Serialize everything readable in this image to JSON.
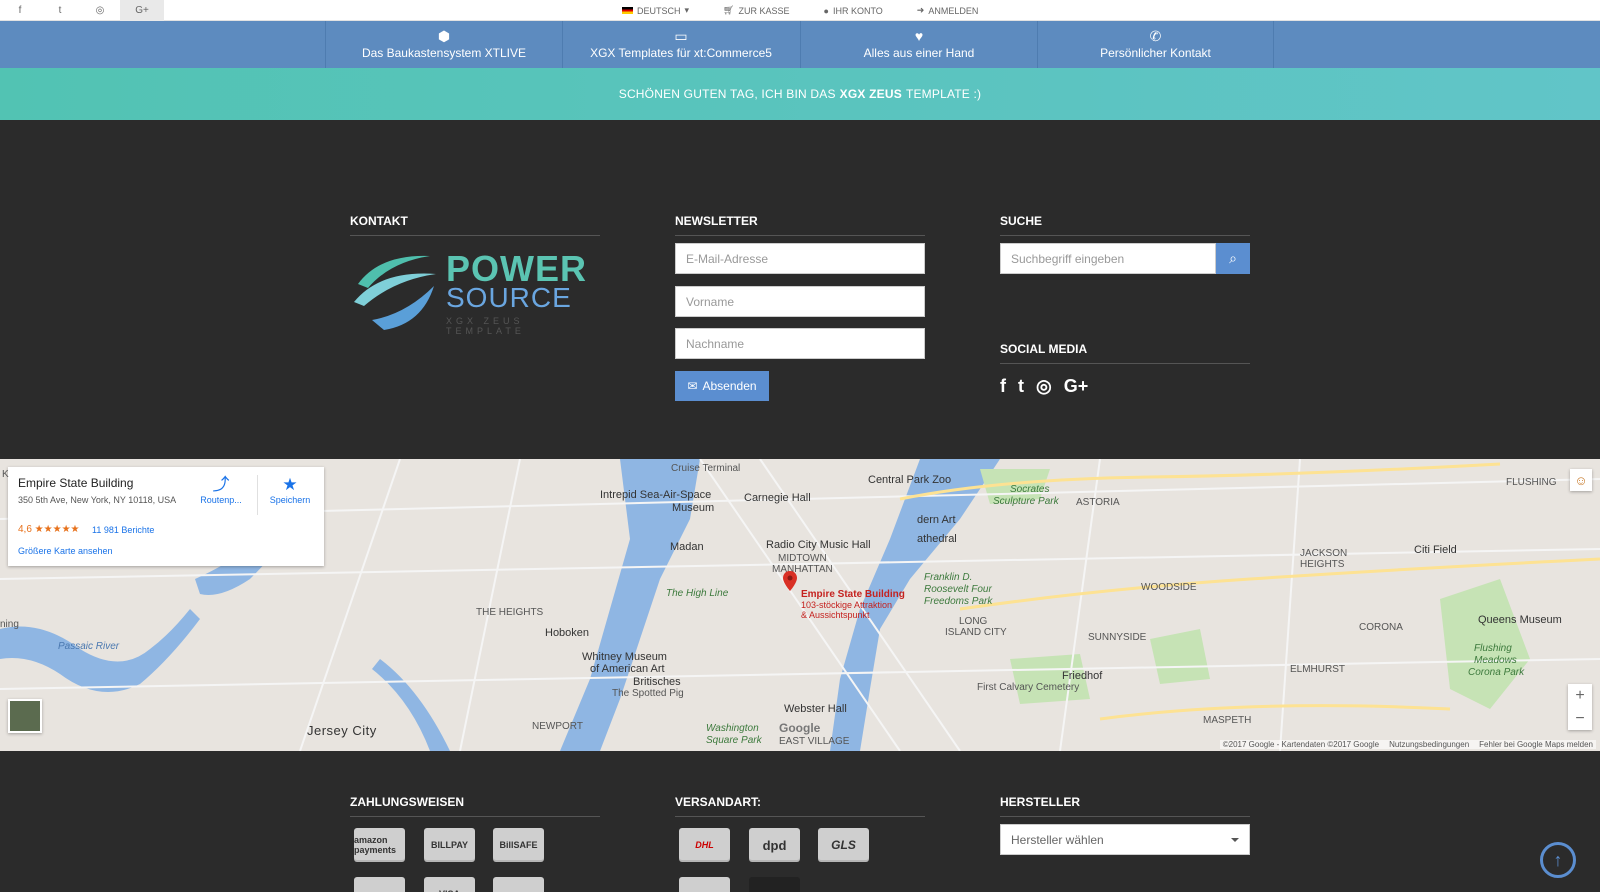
{
  "topbar": {
    "social": [
      {
        "icon": "facebook-icon",
        "glyph": "f"
      },
      {
        "icon": "twitter-icon",
        "glyph": "t"
      },
      {
        "icon": "instagram-icon",
        "glyph": "◎"
      },
      {
        "icon": "googleplus-icon",
        "glyph": "G+"
      }
    ],
    "language": "DEUTSCH",
    "checkout": "ZUR KASSE",
    "account": "IHR KONTO",
    "login": "ANMELDEN"
  },
  "nav": {
    "items": [
      {
        "label": "Das Baukastensystem XTLIVE",
        "icon": "cubes-icon",
        "glyph": "⬢"
      },
      {
        "label": "XGX Templates für xt:Commerce5",
        "icon": "monitor-icon",
        "glyph": "▭"
      },
      {
        "label": "Alles aus einer Hand",
        "icon": "heart-icon",
        "glyph": "♥"
      },
      {
        "label": "Persönlicher Kontakt",
        "icon": "phone-icon",
        "glyph": "✆"
      }
    ]
  },
  "banner": {
    "before": "SCHÖNEN GUTEN TAG, ICH BIN DAS",
    "highlight": "XGX ZEUS",
    "after": "TEMPLATE :)"
  },
  "contact": {
    "title": "KONTAKT",
    "logo_line1": "POWER",
    "logo_line2": "SOURCE",
    "logo_tagline": "XGX ZEUS TEMPLATE"
  },
  "newsletter": {
    "title": "NEWSLETTER",
    "email_placeholder": "E-Mail-Adresse",
    "firstname_placeholder": "Vorname",
    "lastname_placeholder": "Nachname",
    "submit": "Absenden"
  },
  "search": {
    "title": "SUCHE",
    "placeholder": "Suchbegriff eingeben"
  },
  "social_media": {
    "title": "SOCIAL MEDIA",
    "icons": [
      "f",
      "t",
      "◎",
      "G+"
    ]
  },
  "map": {
    "place_name": "Empire State Building",
    "address": "350 5th Ave, New York, NY 10118, USA",
    "rating": "4,6 ★★★★★",
    "reviews": "11 981 Berichte",
    "bigger_map": "Größere Karte ansehen",
    "route": "Routenp...",
    "save": "Speichern",
    "marker_title": "Empire State Building",
    "marker_sub1": "103-stöckige Attraktion",
    "marker_sub2": "& Aussichtspunkt",
    "labels": {
      "cruise": "Cruise Terminal",
      "intrepid": "Intrepid Sea-Air-Space",
      "museum": "Museum",
      "carnegie": "Carnegie Hall",
      "central_zoo": "Central Park Zoo",
      "modern_art": "dern Art",
      "cathedral": "athedral",
      "radio": "Radio City Music Hall",
      "midtown": "MIDTOWN",
      "manhattan": "MANHATTAN",
      "madan": "Madan",
      "highline": "The High Line",
      "heights": "THE HEIGHTS",
      "hoboken": "Hoboken",
      "whitney": "Whitney Museum",
      "whitney2": "of American Art",
      "britisches": "Britisches",
      "spotted": "The Spotted Pig",
      "webster": "Webster Hall",
      "washington": "Washington",
      "square": "Square Park",
      "eastvillage": "EAST VILLAGE",
      "jersey": "Jersey City",
      "newport": "NEWPORT",
      "socrates": "Socrates",
      "sculpture": "Sculpture Park",
      "astoria": "ASTORIA",
      "fdr1": "Franklin D.",
      "fdr2": "Roosevelt Four",
      "fdr3": "Freedoms Park",
      "longisland1": "LONG",
      "longisland2": "ISLAND CITY",
      "woodside": "WOODSIDE",
      "sunnyside": "SUNNYSIDE",
      "jackson1": "JACKSON",
      "jackson2": "HEIGHTS",
      "corona": "CORONA",
      "citifield": "Citi Field",
      "queens": "Queens Museum",
      "flushing": "FLUSHING",
      "flushing_m1": "Flushing",
      "flushing_m2": "Meadows",
      "flushing_m3": "Corona Park",
      "elmhurst": "ELMHURST",
      "maspeth": "MASPETH",
      "friedhof": "Friedhof",
      "calvary": "First Calvary Cemetery",
      "passaic": "Passaic River",
      "ning": "ning"
    },
    "google": "Google",
    "attribution": "©2017 Google - Kartendaten ©2017 Google",
    "terms": "Nutzungsbedingungen",
    "report": "Fehler bei Google Maps melden"
  },
  "payment": {
    "title": "ZAHLUNGSWEISEN",
    "methods": [
      "amazon payments",
      "BILLPAY",
      "BillSAFE",
      "",
      "VISA",
      ""
    ]
  },
  "shipping": {
    "title": "VERSANDART:",
    "carriers": [
      "DHL",
      "dpd",
      "GLS",
      "",
      ""
    ]
  },
  "manufacturer": {
    "title": "HERSTELLER",
    "select_value": "Hersteller wählen"
  },
  "colors": {
    "nav_bg": "#5d8bbf",
    "banner_bg": "#52c3b3",
    "footer_bg": "#2b2b2b",
    "accent": "#5b8ed0"
  }
}
